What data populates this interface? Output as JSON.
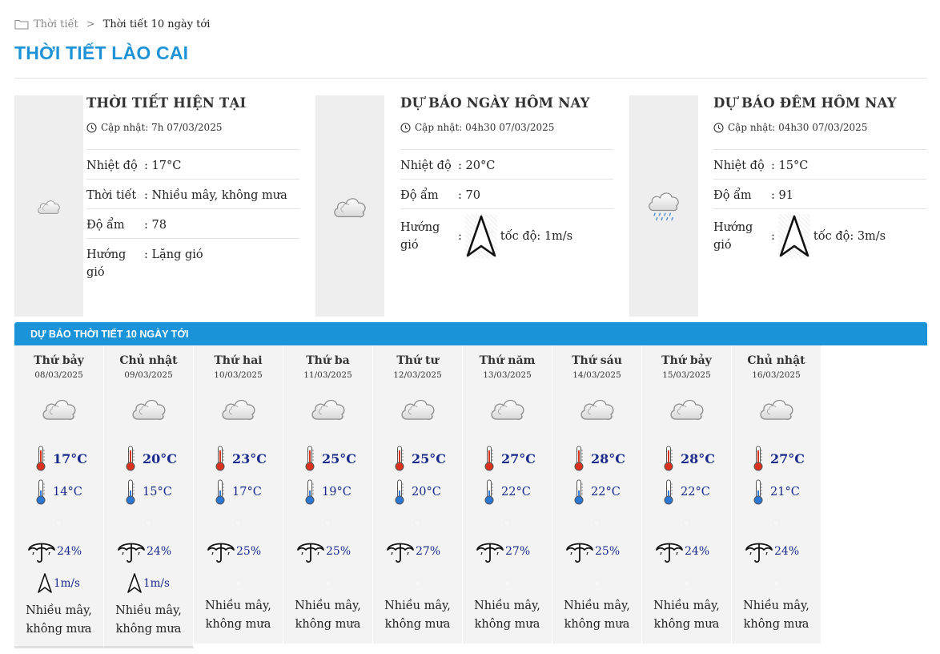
{
  "breadcrumb": {
    "home": "Thời tiết",
    "separator": ">",
    "current": "Thời tiết 10 ngày tới"
  },
  "page_title": "THỜI TIẾT LÀO CAI",
  "colors": {
    "accent": "#1f93d6",
    "forecast_bar": "#1b93d8",
    "value_text": "#1a2a8a"
  },
  "cards": [
    {
      "title": "THỜI TIẾT HIỆN TẠI",
      "updated": "Cập nhật: 7h 07/03/2025",
      "icon": "cloud-icon",
      "rows": [
        {
          "label": "Nhiệt độ",
          "value": ": 17°C"
        },
        {
          "label": "Thời tiết",
          "value": ": Nhiều mây, không mưa"
        },
        {
          "label": "Độ ẩm",
          "value": ": 78"
        },
        {
          "label": "Hướng gió",
          "value": ": Lặng gió"
        }
      ]
    },
    {
      "title": "DỰ BÁO NGÀY HÔM NAY",
      "updated": "Cập nhật: 04h30 07/03/2025",
      "icon": "cloud-icon",
      "rows": [
        {
          "label": "Nhiệt độ",
          "value": ": 20°C"
        },
        {
          "label": "Độ ẩm",
          "value": ": 70"
        }
      ],
      "wind": {
        "label": "Hướng gió",
        "colon": ":",
        "speed": "tốc độ: 1m/s"
      }
    },
    {
      "title": "DỰ BÁO ĐÊM HÔM NAY",
      "updated": "Cập nhật: 04h30 07/03/2025",
      "icon": "rain-cloud-icon",
      "rows": [
        {
          "label": "Nhiệt độ",
          "value": ": 15°C"
        },
        {
          "label": "Độ ẩm",
          "value": ": 91"
        }
      ],
      "wind": {
        "label": "Hướng gió",
        "colon": ":",
        "speed": "tốc độ: 3m/s"
      }
    }
  ],
  "forecast": {
    "header": "DỰ BÁO THỜI TIẾT 10 NGÀY TỚI",
    "days": [
      {
        "name": "Thứ bảy",
        "date": "08/03/2025",
        "max": "17°C",
        "min": "14°C",
        "rain": "24%",
        "wind": "1m/s",
        "desc1": "Nhiều mây,",
        "desc2": "không mưa"
      },
      {
        "name": "Chủ nhật",
        "date": "09/03/2025",
        "max": "20°C",
        "min": "15°C",
        "rain": "24%",
        "wind": "1m/s",
        "desc1": "Nhiều mây,",
        "desc2": "không mưa"
      },
      {
        "name": "Thứ hai",
        "date": "10/03/2025",
        "max": "23°C",
        "min": "17°C",
        "rain": "25%",
        "desc1": "Nhiều mây,",
        "desc2": "không mưa"
      },
      {
        "name": "Thứ ba",
        "date": "11/03/2025",
        "max": "25°C",
        "min": "19°C",
        "rain": "25%",
        "desc1": "Nhiều mây,",
        "desc2": "không mưa"
      },
      {
        "name": "Thứ tư",
        "date": "12/03/2025",
        "max": "25°C",
        "min": "20°C",
        "rain": "27%",
        "desc1": "Nhiều mây,",
        "desc2": "không mưa"
      },
      {
        "name": "Thứ năm",
        "date": "13/03/2025",
        "max": "27°C",
        "min": "22°C",
        "rain": "27%",
        "desc1": "Nhiều mây,",
        "desc2": "không mưa"
      },
      {
        "name": "Thứ sáu",
        "date": "14/03/2025",
        "max": "28°C",
        "min": "22°C",
        "rain": "25%",
        "desc1": "Nhiều mây,",
        "desc2": "không mưa"
      },
      {
        "name": "Thứ bảy",
        "date": "15/03/2025",
        "max": "28°C",
        "min": "22°C",
        "rain": "24%",
        "desc1": "Nhiều mây,",
        "desc2": "không mưa"
      },
      {
        "name": "Chủ nhật",
        "date": "16/03/2025",
        "max": "27°C",
        "min": "21°C",
        "rain": "24%",
        "desc1": "Nhiều mây,",
        "desc2": "không mưa"
      }
    ]
  }
}
